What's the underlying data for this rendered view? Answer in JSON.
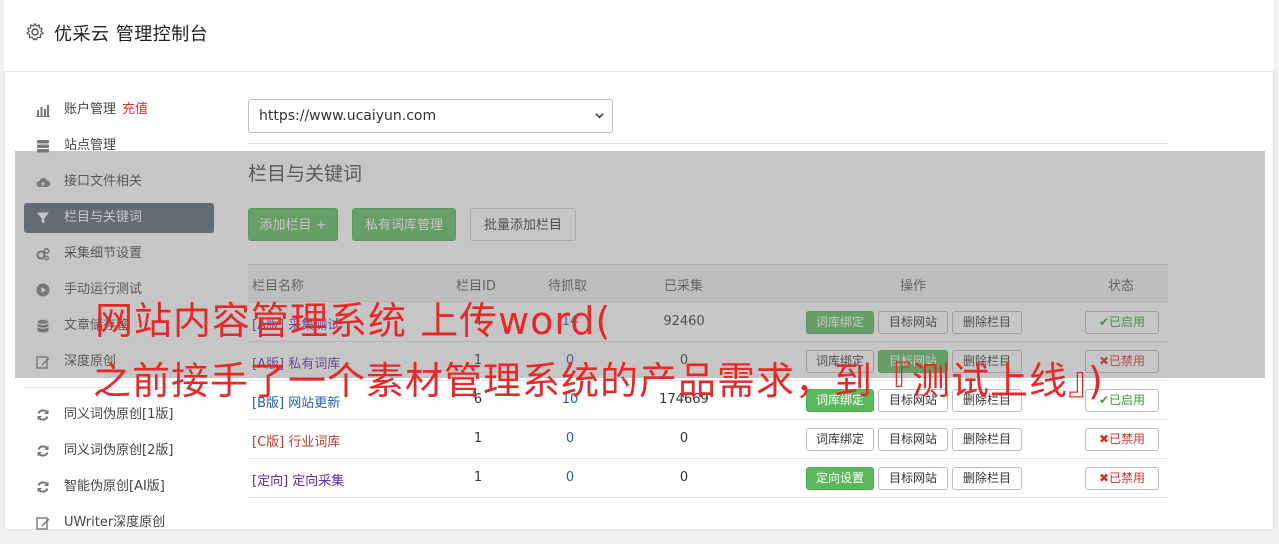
{
  "app": {
    "title": "优采云 管理控制台",
    "gear_icon": "gear-icon"
  },
  "sidebar": {
    "items": [
      {
        "label": "账户管理",
        "extra": "充值",
        "icon": "bar-chart-icon",
        "active": false
      },
      {
        "label": "站点管理",
        "icon": "server-icon",
        "active": false
      },
      {
        "label": "接口文件相关",
        "icon": "cloud-upload-icon",
        "active": false
      },
      {
        "label": "栏目与关键词",
        "icon": "filter-icon",
        "active": true
      },
      {
        "label": "采集细节设置",
        "icon": "gears-icon",
        "active": false
      },
      {
        "label": "手动运行测试",
        "icon": "play-circle-icon",
        "active": false
      },
      {
        "label": "文章储存管",
        "icon": "database-icon",
        "active": false
      },
      {
        "label": "深度原创",
        "icon": "edit-icon",
        "active": false
      }
    ],
    "items2": [
      {
        "label": "同义词伪原创[1版]",
        "icon": "refresh-icon"
      },
      {
        "label": "同义词伪原创[2版]",
        "icon": "refresh-icon"
      },
      {
        "label": "智能伪原创[AI版]",
        "icon": "refresh-icon"
      },
      {
        "label": "UWriter深度原创",
        "icon": "edit-icon"
      }
    ]
  },
  "main": {
    "site_select": "https://www.ucaiyun.com",
    "section_title": "栏目与关键词",
    "buttons": {
      "add_column": "添加栏目 +",
      "private_lexicon": "私有词库管理",
      "batch_add": "批量添加栏目"
    },
    "table": {
      "headers": {
        "name": "栏目名称",
        "id": "栏目ID",
        "pending": "待抓取",
        "collected": "已采集",
        "ops": "操作",
        "status": "状态"
      },
      "rows": [
        {
          "tag": "[A版]",
          "name": "采集测试",
          "id": "4",
          "pending": "14",
          "collected": "92460",
          "op1": "词库绑定",
          "op2": "目标网站",
          "op3": "删除栏目",
          "status": "已启用",
          "state": "on",
          "op1_green": true,
          "op2_green": false
        },
        {
          "tag": "[A版]",
          "name": "私有词库",
          "id": "1",
          "pending": "0",
          "collected": "0",
          "op1": "词库绑定",
          "op2": "目标网站",
          "op3": "删除栏目",
          "status": "已禁用",
          "state": "off",
          "op1_green": false,
          "op2_green": true
        },
        {
          "tag": "[B版]",
          "name": "网站更新",
          "id": "6",
          "pending": "10",
          "collected": "174669",
          "op1": "词库绑定",
          "op2": "目标网站",
          "op3": "删除栏目",
          "status": "已启用",
          "state": "on",
          "op1_green": true,
          "op2_green": false
        },
        {
          "tag": "[C版]",
          "name": "行业词库",
          "id": "1",
          "pending": "0",
          "collected": "0",
          "op1": "词库绑定",
          "op2": "目标网站",
          "op3": "删除栏目",
          "status": "已禁用",
          "state": "off",
          "op1_green": false,
          "op2_green": false
        },
        {
          "tag": "[定向]",
          "name": "定向采集",
          "id": "1",
          "pending": "0",
          "collected": "0",
          "op1": "定向设置",
          "op2": "目标网站",
          "op3": "删除栏目",
          "status": "已禁用",
          "state": "off",
          "op1_green": true,
          "op2_green": false
        }
      ]
    }
  },
  "overlay_caption": {
    "line1": "网站内容管理系统 上传word(",
    "line2": "之前接手了一个素材管理系统的产品需求，到『测试上线』)"
  }
}
